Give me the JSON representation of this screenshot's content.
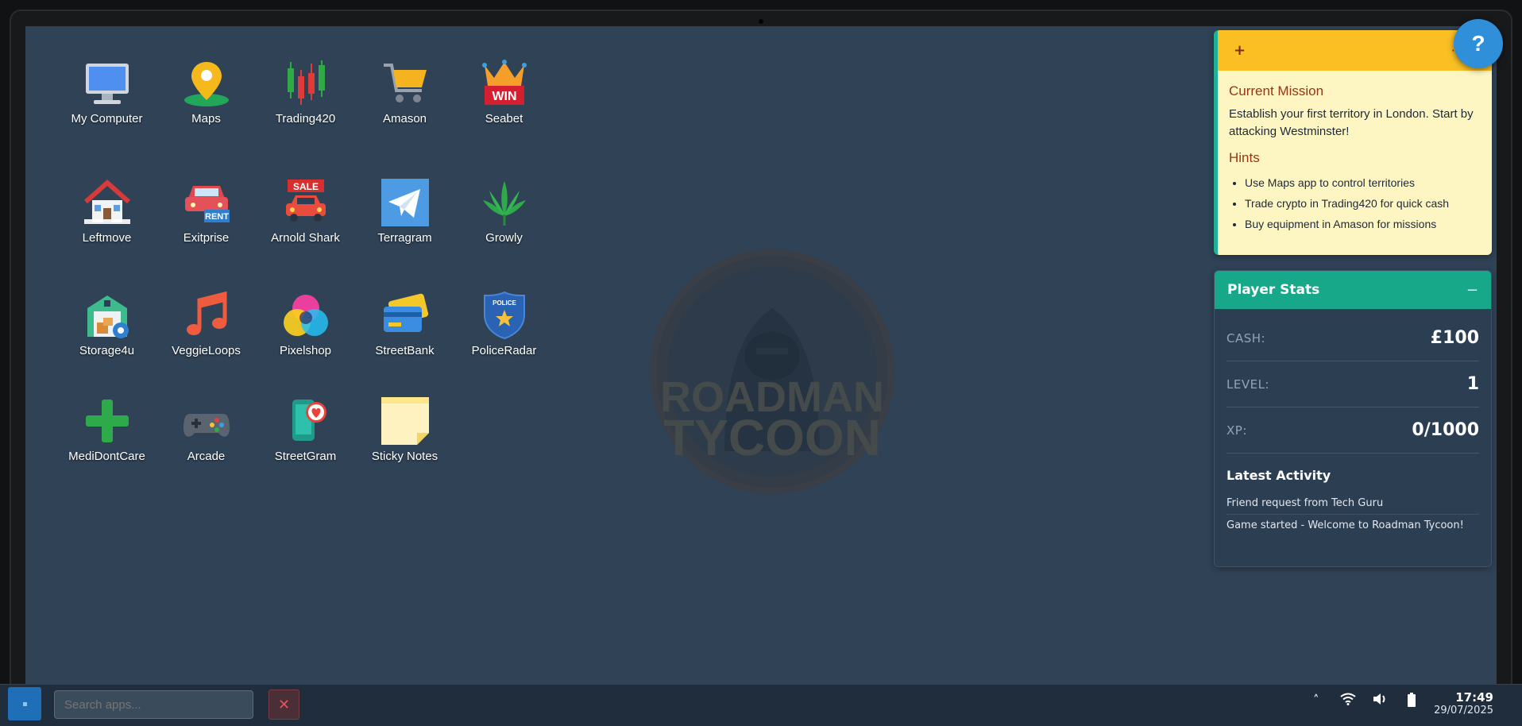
{
  "desktop": {
    "apps": [
      {
        "label": "My Computer",
        "icon": "computer-icon"
      },
      {
        "label": "Maps",
        "icon": "map-pin-icon"
      },
      {
        "label": "Trading420",
        "icon": "candlestick-chart-icon"
      },
      {
        "label": "Amason",
        "icon": "shopping-cart-icon"
      },
      {
        "label": "Seabet",
        "icon": "crown-win-icon"
      },
      {
        "label": "Leftmove",
        "icon": "house-icon"
      },
      {
        "label": "Exitprise",
        "icon": "rent-car-icon"
      },
      {
        "label": "Arnold Shark",
        "icon": "sale-car-icon"
      },
      {
        "label": "Terragram",
        "icon": "paper-plane-icon"
      },
      {
        "label": "Growly",
        "icon": "leaf-icon"
      },
      {
        "label": "Storage4u",
        "icon": "storage-unit-icon"
      },
      {
        "label": "VeggieLoops",
        "icon": "music-note-icon"
      },
      {
        "label": "Pixelshop",
        "icon": "color-circles-icon"
      },
      {
        "label": "StreetBank",
        "icon": "credit-card-icon"
      },
      {
        "label": "PoliceRadar",
        "icon": "police-badge-icon"
      },
      {
        "label": "MediDontCare",
        "icon": "medical-cross-icon"
      },
      {
        "label": "Arcade",
        "icon": "gamepad-icon"
      },
      {
        "label": "StreetGram",
        "icon": "phone-heart-icon"
      },
      {
        "label": "Sticky Notes",
        "icon": "sticky-note-icon"
      }
    ],
    "watermark_text": [
      "ROADMAN",
      "TYCOON"
    ]
  },
  "sticky_note": {
    "add_label": "+",
    "menu_label": "···",
    "mission_title": "Current Mission",
    "mission_text": "Establish your first territory in London. Start by attacking Westminster!",
    "hints_title": "Hints",
    "hints": [
      "Use Maps app to control territories",
      "Trade crypto in Trading420 for quick cash",
      "Buy equipment in Amason for missions"
    ]
  },
  "help_button": {
    "label": "?"
  },
  "player_stats": {
    "title": "Player Stats",
    "minimize_label": "−",
    "cash_label": "CASH:",
    "cash_value": "£100",
    "level_label": "LEVEL:",
    "level_value": "1",
    "xp_label": "XP:",
    "xp_value": "0/1000",
    "activity_title": "Latest Activity",
    "activity": [
      "Friend request from Tech Guru",
      "Game started - Welcome to Roadman Tycoon!"
    ]
  },
  "taskbar": {
    "search_placeholder": "Search apps...",
    "close_label": "✕",
    "tray_chevron": "˄",
    "time": "17:49",
    "date": "29/07/2025"
  },
  "colors": {
    "desktop_bg": "#2f4256",
    "sticky_header": "#fbbf24",
    "sticky_bg": "#fdf6c3",
    "stats_header": "#17a88a",
    "accent_blue": "#2f8fd8"
  }
}
